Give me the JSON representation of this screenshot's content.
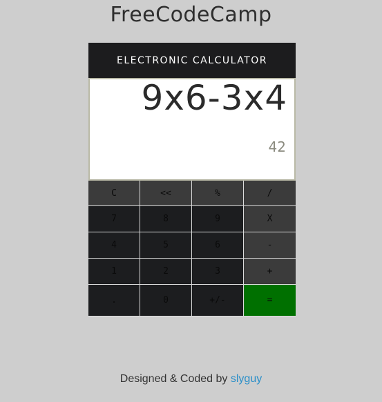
{
  "site": {
    "title": "FreeCodeCamp"
  },
  "calculator": {
    "header": "ELECTRONIC CALCULATOR",
    "display": {
      "expression": "9x6-3x4",
      "result": "42"
    },
    "keys": {
      "clear": "C",
      "backspace": "<<",
      "percent": "%",
      "divide": "/",
      "seven": "7",
      "eight": "8",
      "nine": "9",
      "multiply": "X",
      "four": "4",
      "five": "5",
      "six": "6",
      "subtract": "-",
      "one": "1",
      "two": "2",
      "three": "3",
      "add": "+",
      "decimal": ".",
      "zero": "0",
      "plus_minus": "+/-",
      "equals": "="
    }
  },
  "footer": {
    "text": "Designed & Coded by",
    "author": "slyguy"
  },
  "colors": {
    "page_background": "#cecece",
    "header_background": "#1c1c1e",
    "equals_key": "#007000",
    "link": "#2a8fc9"
  }
}
